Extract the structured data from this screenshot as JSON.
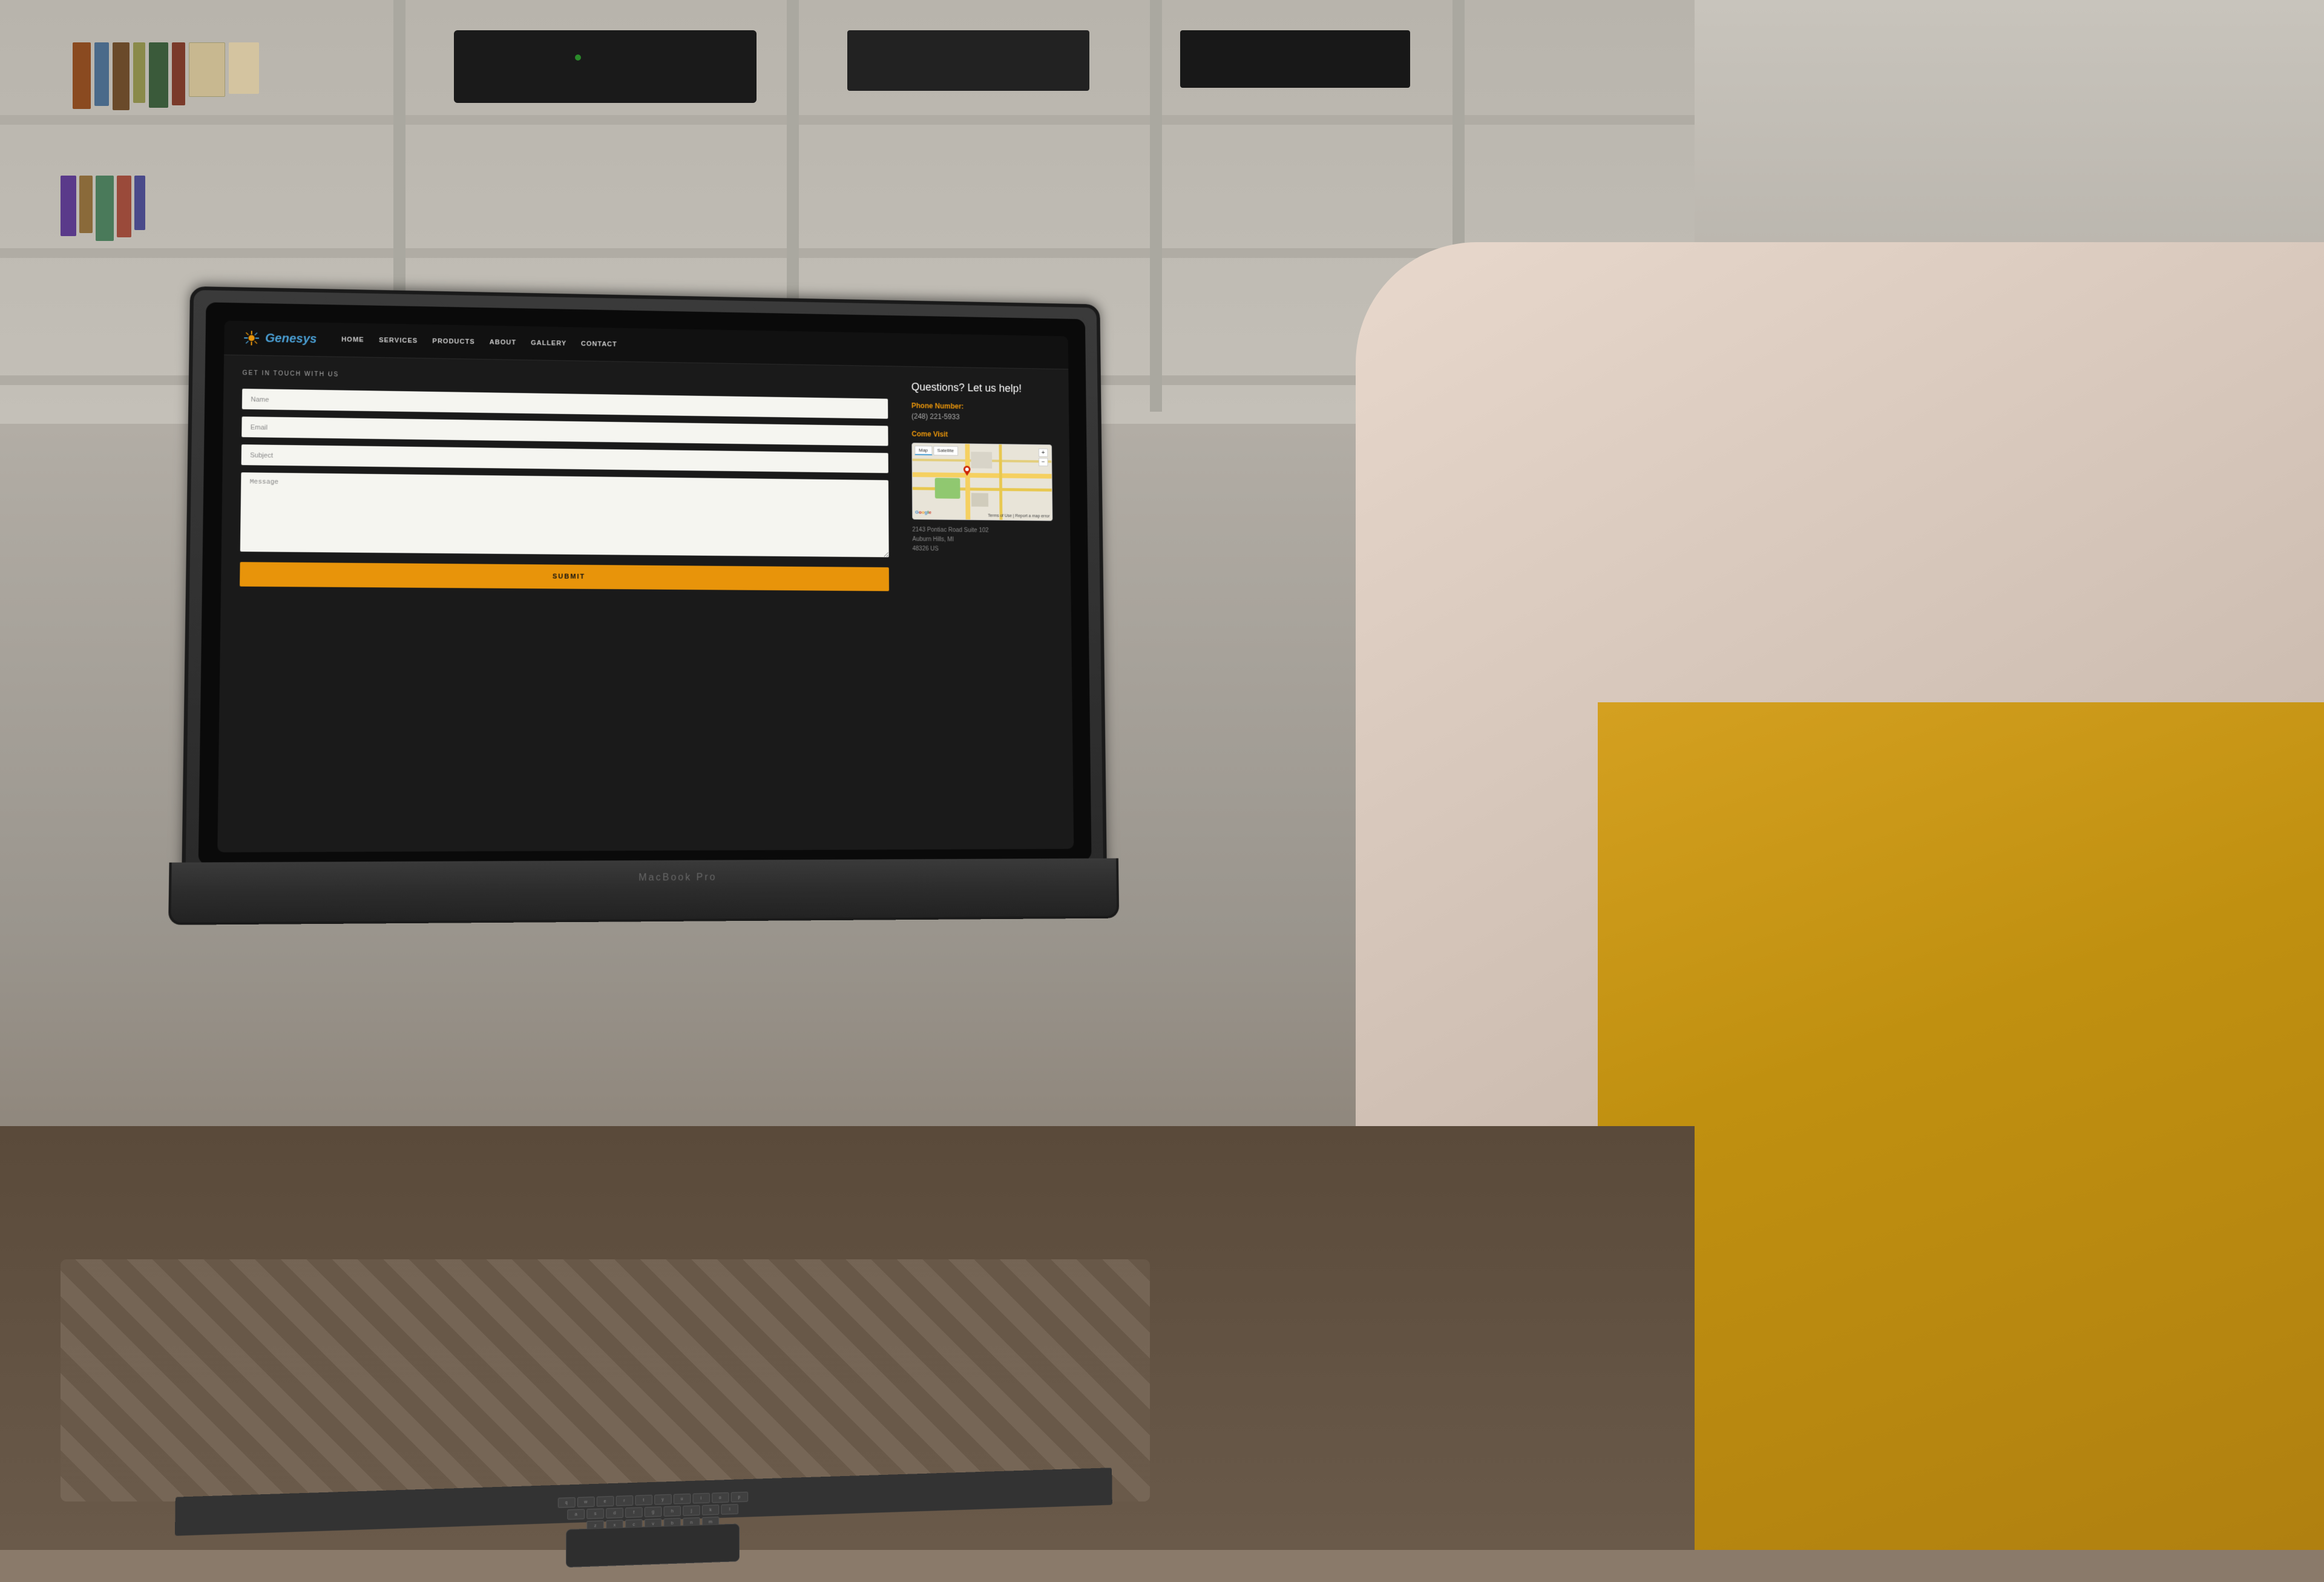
{
  "background": {
    "description": "Room with bookshelf and couch, MacBook Pro on lap"
  },
  "website": {
    "brand": {
      "name": "Genesys",
      "logo_alt": "Genesys logo star"
    },
    "nav": {
      "links": [
        "HOME",
        "SERVICES",
        "PRODUCTS",
        "ABOUT",
        "GALLERY",
        "CONTACT"
      ]
    },
    "contact_page": {
      "section_title": "GET IN TOUCH WITH US",
      "form": {
        "name_placeholder": "Name",
        "email_placeholder": "Email",
        "subject_placeholder": "Subject",
        "message_placeholder": "Message",
        "submit_label": "SUBMIT"
      },
      "info": {
        "questions_title": "Questions? Let us help!",
        "phone_label": "Phone Number:",
        "phone_number": "(248) 221-5933",
        "visit_label": "Come Visit",
        "address_line1": "2143 Pontiac Road Suite 102",
        "address_line2": "Auburn Hills, MI",
        "address_line3": "48326 US",
        "map": {
          "tab_map": "Map",
          "tab_satellite": "Satellite",
          "zoom_in": "+",
          "zoom_out": "−"
        }
      }
    }
  },
  "macbook_label": "MacBook Pro",
  "colors": {
    "accent": "#e8940a",
    "nav_bg": "#111111",
    "screen_bg": "#1a1a1a",
    "logo_color": "#4a9fd4",
    "text_light": "#aaaaaa",
    "text_white": "#ffffff"
  }
}
